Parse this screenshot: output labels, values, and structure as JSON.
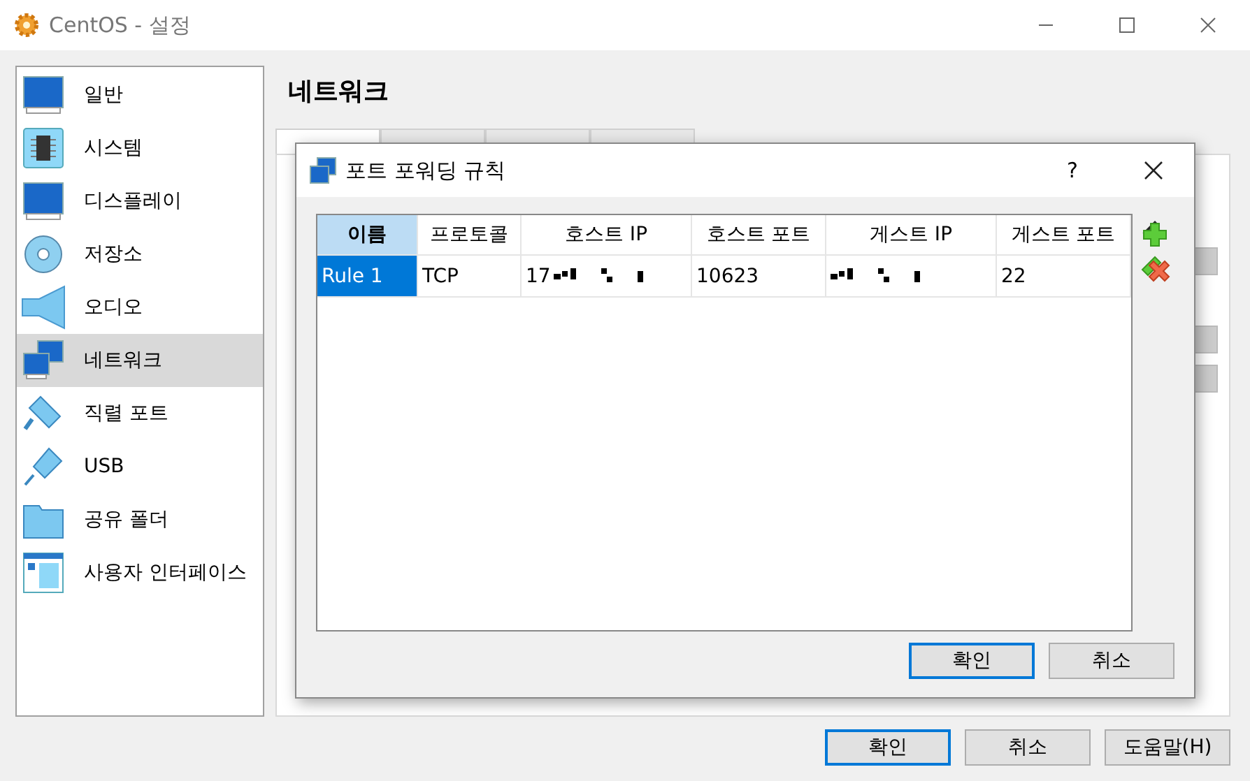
{
  "window": {
    "title": "CentOS - 설정"
  },
  "sidebar": {
    "items": [
      {
        "label": "일반",
        "kind": "general",
        "selected": false
      },
      {
        "label": "시스템",
        "kind": "system",
        "selected": false
      },
      {
        "label": "디스플레이",
        "kind": "display",
        "selected": false
      },
      {
        "label": "저장소",
        "kind": "storage",
        "selected": false
      },
      {
        "label": "오디오",
        "kind": "audio",
        "selected": false
      },
      {
        "label": "네트워크",
        "kind": "network",
        "selected": true
      },
      {
        "label": "직렬 포트",
        "kind": "serial",
        "selected": false
      },
      {
        "label": "USB",
        "kind": "usb",
        "selected": false
      },
      {
        "label": "공유 폴더",
        "kind": "folder",
        "selected": false
      },
      {
        "label": "사용자 인터페이스",
        "kind": "ui",
        "selected": false
      }
    ]
  },
  "page": {
    "heading": "네트워크",
    "tabs": [
      {
        "selected": true
      },
      {
        "selected": false
      },
      {
        "selected": false
      },
      {
        "selected": false
      }
    ]
  },
  "dialog": {
    "title": "포트 포워딩 규칙",
    "help": "?",
    "columns": [
      {
        "label": "이름",
        "selected": true
      },
      {
        "label": "프로토콜",
        "selected": false
      },
      {
        "label": "호스트 IP",
        "selected": false
      },
      {
        "label": "호스트 포트",
        "selected": false
      },
      {
        "label": "게스트 IP",
        "selected": false
      },
      {
        "label": "게스트 포트",
        "selected": false
      }
    ],
    "rows": [
      {
        "selected": true,
        "cells": [
          {
            "text": "Rule 1",
            "redacted": false
          },
          {
            "text": "TCP",
            "redacted": false
          },
          {
            "text": "17",
            "redacted": true
          },
          {
            "text": "10623",
            "redacted": false
          },
          {
            "redacted": true
          },
          {
            "text": "22",
            "redacted": false
          }
        ]
      }
    ],
    "buttons": [
      {
        "label": "확인",
        "default": true
      },
      {
        "label": "취소",
        "default": false
      }
    ]
  },
  "buttons": [
    {
      "label": "확인",
      "default": true
    },
    {
      "label": "취소",
      "default": false
    },
    {
      "label": "도움말(H)",
      "default": false
    }
  ]
}
